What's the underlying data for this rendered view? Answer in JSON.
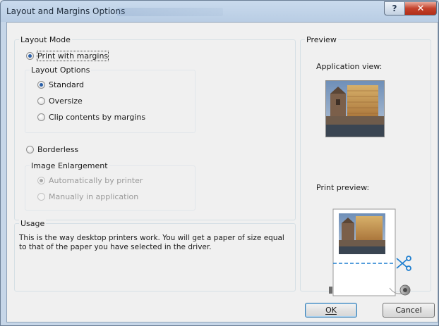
{
  "window": {
    "title": "Layout and Margins Options",
    "help_glyph": "?",
    "close_glyph": "✕"
  },
  "layout_mode": {
    "group_label": "Layout Mode",
    "print_with_margins": {
      "label": "Print with margins",
      "checked": true
    },
    "layout_options": {
      "group_label": "Layout Options",
      "options": [
        {
          "label": "Standard",
          "checked": true
        },
        {
          "label": "Oversize",
          "checked": false
        },
        {
          "label": "Clip contents by margins",
          "checked": false
        }
      ]
    },
    "borderless": {
      "label": "Borderless",
      "checked": false
    },
    "image_enlargement": {
      "group_label": "Image Enlargement",
      "options": [
        {
          "label": "Automatically by printer",
          "checked": true,
          "disabled": true
        },
        {
          "label": "Manually in application",
          "checked": false,
          "disabled": true
        }
      ]
    }
  },
  "usage": {
    "group_label": "Usage",
    "text": "This is the way desktop printers work. You will get a paper of size equal to that of the paper you have selected in the driver."
  },
  "preview": {
    "group_label": "Preview",
    "application_view_label": "Application view:",
    "print_preview_label": "Print preview:"
  },
  "buttons": {
    "ok": "OK",
    "cancel": "Cancel"
  },
  "colors": {
    "accent": "#2a5fa8",
    "cut_line": "#1f7fd0"
  }
}
